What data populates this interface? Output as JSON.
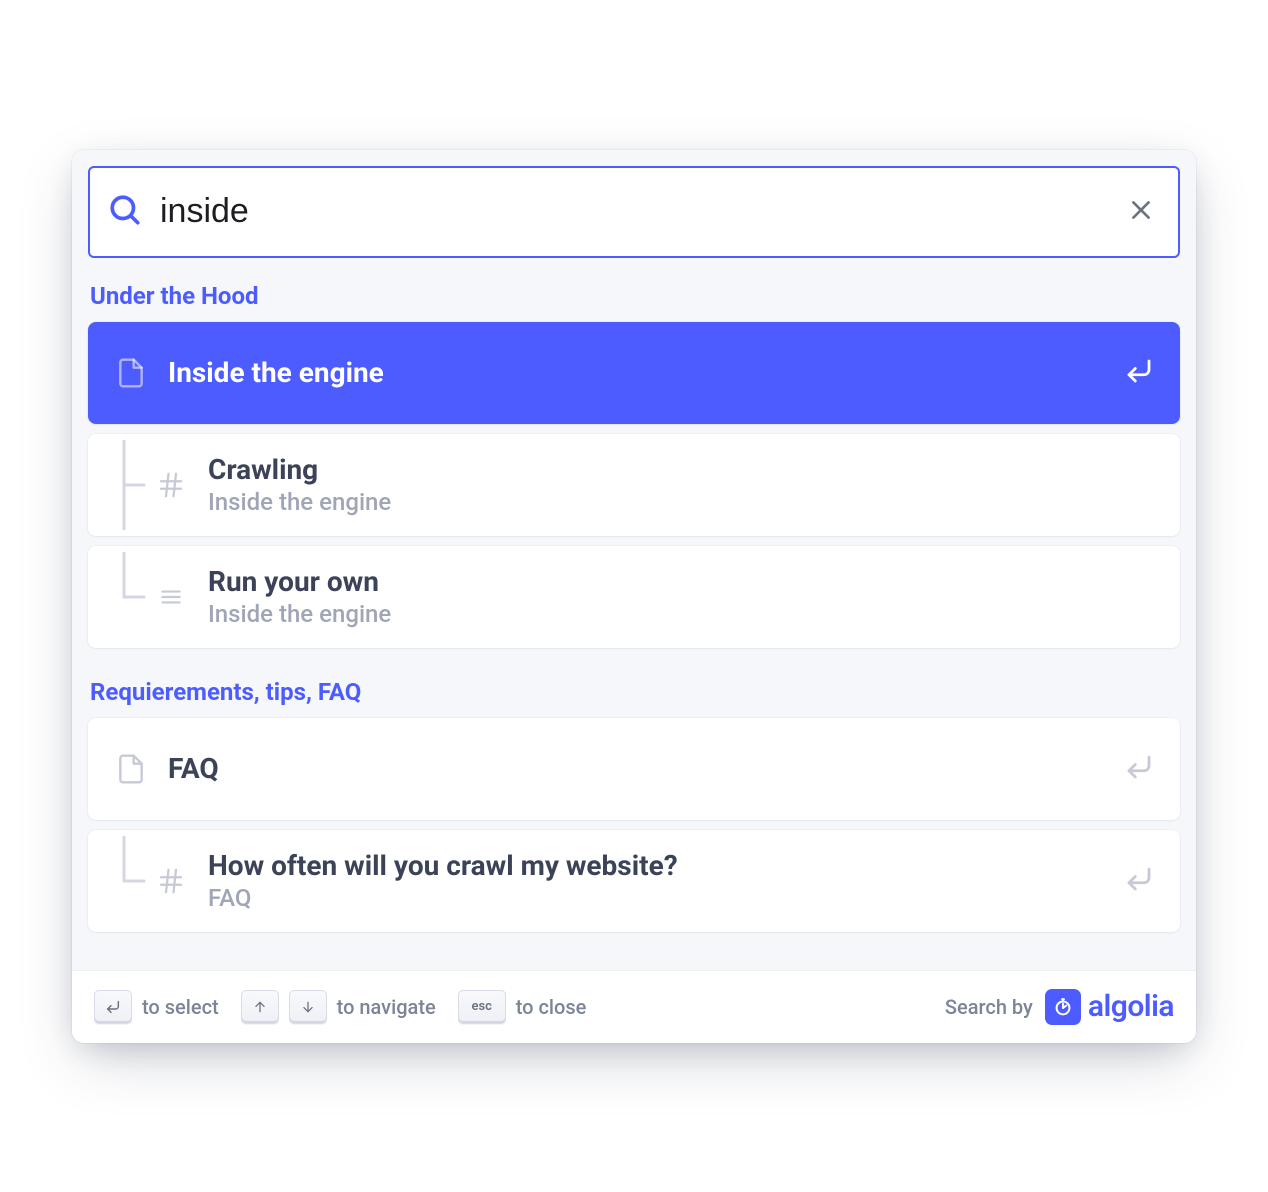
{
  "search": {
    "value": "inside",
    "placeholder": "Search"
  },
  "sections": [
    {
      "heading": "Under the Hood",
      "items": [
        {
          "type": "page",
          "selected": true,
          "title": "Inside the engine",
          "subtitle": null,
          "tree": "none",
          "goto": true
        },
        {
          "type": "hash",
          "selected": false,
          "title": "Crawling",
          "subtitle": "Inside the engine",
          "tree": "mid",
          "goto": false
        },
        {
          "type": "list",
          "selected": false,
          "title": "Run your own",
          "subtitle": "Inside the engine",
          "tree": "last",
          "goto": false
        }
      ]
    },
    {
      "heading": "Requierements, tips, FAQ",
      "items": [
        {
          "type": "page",
          "selected": false,
          "title": "FAQ",
          "subtitle": null,
          "tree": "none",
          "goto": true
        },
        {
          "type": "hash",
          "selected": false,
          "title": "How often will you crawl my website?",
          "subtitle": "FAQ",
          "tree": "last",
          "goto": true
        }
      ]
    }
  ],
  "footer": {
    "select": "to select",
    "navigate": "to navigate",
    "close": "to close",
    "esc_label": "esc",
    "search_by": "Search by",
    "brand": "algolia"
  }
}
